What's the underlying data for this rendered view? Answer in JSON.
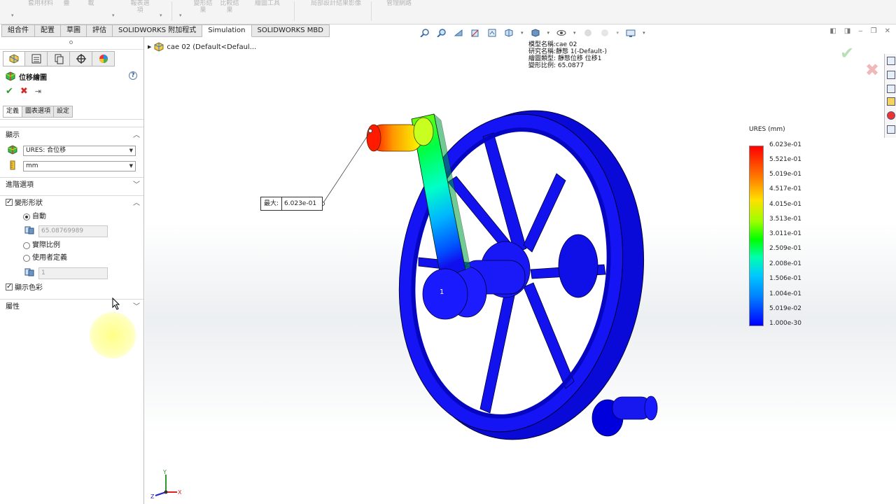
{
  "ribbon": {
    "groups": [
      "套用材料",
      "疊",
      "載",
      "報表選項",
      "變形結果",
      "比較結果",
      "繪圖工具",
      "局部設計結果影像",
      "管理網路"
    ]
  },
  "tabs": [
    "組合件",
    "配置",
    "草圖",
    "評估",
    "SOLIDWORKS 附加程式",
    "Simulation",
    "SOLIDWORKS MBD"
  ],
  "panel": {
    "title": "位移繪圖",
    "help": "?",
    "subtabs": [
      "定義",
      "圖表選項",
      "設定"
    ],
    "display_section": "顯示",
    "component_value": "URES:  合位移",
    "unit_value": "mm",
    "advanced_section": "進階選項",
    "deformed_section": "變形形狀",
    "radio_auto": "自動",
    "auto_scale_value": "65.08769989",
    "radio_true_scale": "實際比例",
    "radio_user": "使用者定義",
    "user_scale_value": "1",
    "show_color_label": "顯示色彩",
    "properties_section": "屬性"
  },
  "viewport": {
    "tree_item": "cae 02  (Default<Defaul...",
    "info_lines": [
      "模型名稱:cae 02",
      "研究名稱:靜態 1(-Default-)",
      "繪圖類型: 靜態位移 位移1",
      "變形比例: 65.0877"
    ],
    "probe_key": "最大:",
    "probe_value": "6.023e-01",
    "node_label": "1",
    "legend_title": "URES (mm)",
    "legend_values": [
      "6.023e-01",
      "5.521e-01",
      "5.019e-01",
      "4.517e-01",
      "4.015e-01",
      "3.513e-01",
      "3.011e-01",
      "2.509e-01",
      "2.008e-01",
      "1.506e-01",
      "1.004e-01",
      "5.019e-02",
      "1.000e-30"
    ]
  },
  "colors": {
    "model_blue": "#1010ee",
    "max_red": "#ff0000",
    "ok_green": "#2e9a2e",
    "cancel_red": "#d42a2a"
  }
}
